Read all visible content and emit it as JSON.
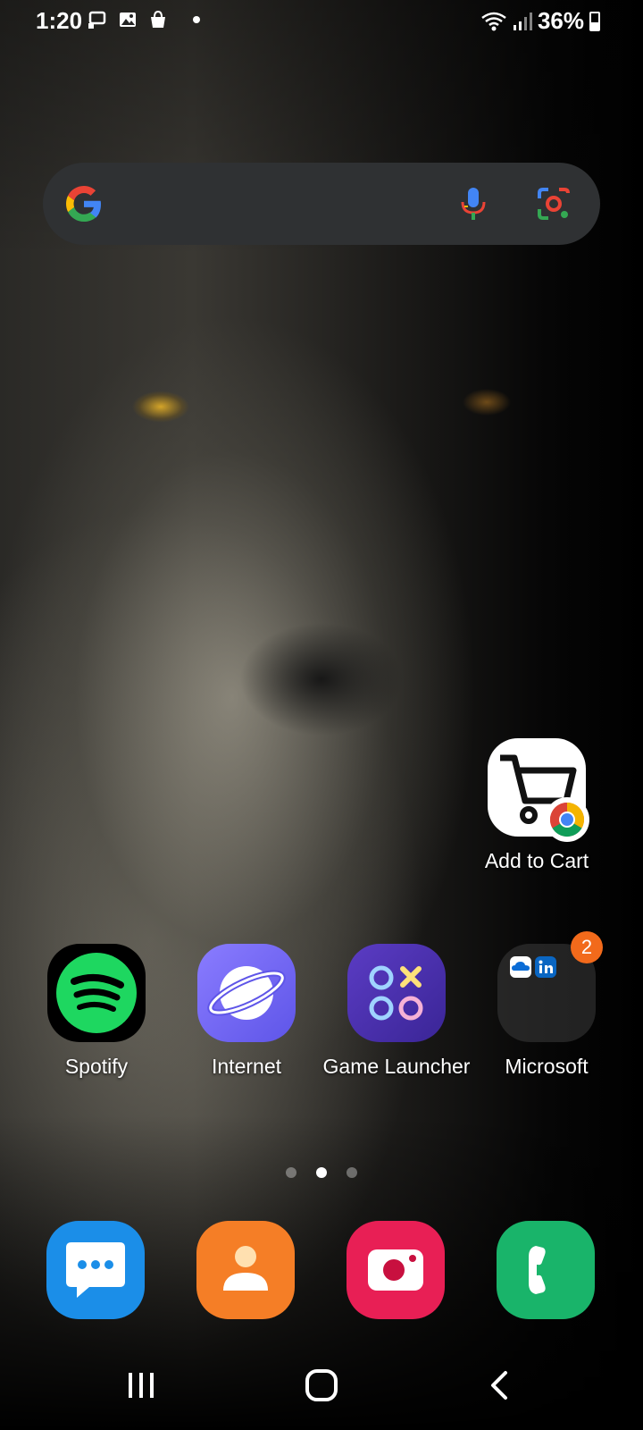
{
  "status_bar": {
    "time": "1:20",
    "battery_percent": "36%",
    "icons_left": [
      "cast-icon",
      "image-icon",
      "shop-bag-icon",
      "notification-dot-icon"
    ],
    "icons_right": [
      "wifi-icon",
      "signal-icon",
      "battery-icon"
    ]
  },
  "search_bar": {
    "logo": "google-logo-icon",
    "mic": "microphone-icon",
    "lens": "google-lens-icon"
  },
  "shortcut": {
    "label": "Add to Cart",
    "icon": "shopping-cart-icon",
    "badge_icon": "chrome-icon"
  },
  "apps": [
    {
      "label": "Spotify",
      "icon": "spotify-icon"
    },
    {
      "label": "Internet",
      "icon": "samsung-internet-icon"
    },
    {
      "label": "Game Launcher",
      "icon": "game-launcher-icon"
    },
    {
      "label": "Microsoft",
      "icon": "folder-icon",
      "badge": "2"
    }
  ],
  "page_indicator": {
    "total": 3,
    "current_index": 1
  },
  "dock": [
    {
      "name": "Messages",
      "icon": "messages-icon",
      "color": "#1b8ee8"
    },
    {
      "name": "Contacts",
      "icon": "contacts-icon",
      "color": "#f57e26"
    },
    {
      "name": "Camera",
      "icon": "camera-icon",
      "color": "#e81f55"
    },
    {
      "name": "Phone",
      "icon": "phone-icon",
      "color": "#19b46a"
    }
  ],
  "nav_bar": [
    "recents-icon",
    "home-icon",
    "back-icon"
  ]
}
